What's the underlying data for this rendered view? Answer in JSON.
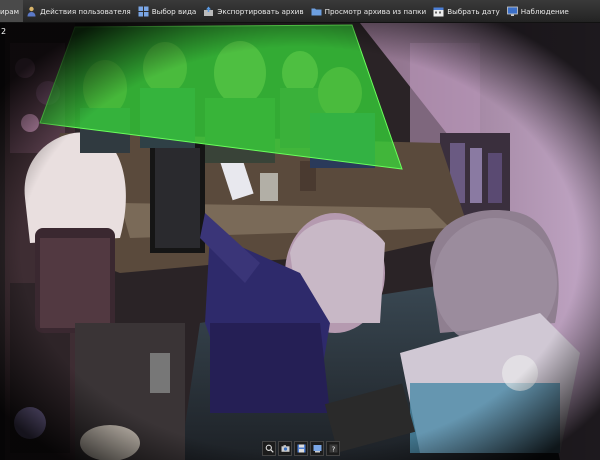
{
  "toolbar": {
    "items": [
      {
        "label": "ирам",
        "icon": "cut-off-icon"
      },
      {
        "label": "Действия пользователя",
        "icon": "user-actions-icon"
      },
      {
        "label": "Выбор вида",
        "icon": "view-grid-icon"
      },
      {
        "label": "Экспортировать архив",
        "icon": "export-archive-icon"
      },
      {
        "label": "Просмотр архива из папки",
        "icon": "folder-icon"
      },
      {
        "label": "Выбрать дату",
        "icon": "calendar-icon"
      },
      {
        "label": "Наблюдение",
        "icon": "monitor-icon"
      }
    ]
  },
  "camera": {
    "number": "2",
    "detection_zone_color": "#37e03a"
  },
  "bottom_controls": [
    "zoom-icon",
    "snapshot-icon",
    "save-icon",
    "export-icon",
    "help-icon"
  ],
  "colors": {
    "toolbar_bg": "#2e2e2e",
    "toolbar_text": "#e8e8e8",
    "zone": "#37e03a"
  }
}
